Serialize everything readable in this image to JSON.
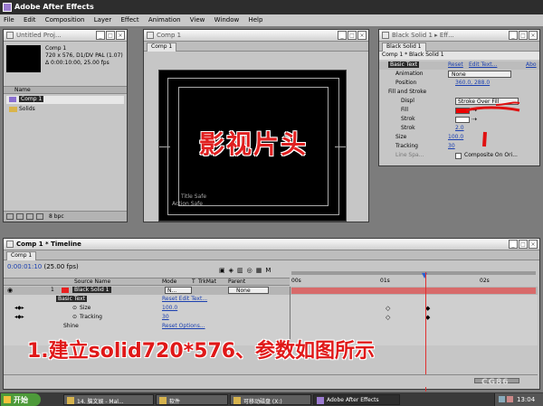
{
  "app": {
    "title": "Adobe After Effects",
    "menu": [
      "File",
      "Edit",
      "Composition",
      "Layer",
      "Effect",
      "Animation",
      "View",
      "Window",
      "Help"
    ]
  },
  "project": {
    "title": "Untitled Proj...",
    "comp_name": "Comp 1",
    "comp_size": "720 x 576, D1/DV PAL (1.07)",
    "comp_duration": "Δ 0:00:10:00, 25.00 fps",
    "column_name": "Name",
    "items": [
      {
        "label": "Comp 1"
      },
      {
        "label": "Solids"
      }
    ],
    "bpc": "8 bpc"
  },
  "comp_window": {
    "title": "Comp 1",
    "tab": "Comp 1",
    "overlay_text": "影视片头",
    "title_safe": "Title Safe",
    "action_safe": "Action Safe"
  },
  "effect_controls": {
    "title": "Black Solid 1 ▸ Eff...",
    "tab": "Black Solid 1",
    "breadcrumb": "Comp 1 * Black Solid 1",
    "effect_name": "Basic Text",
    "reset": "Reset",
    "edit_text": "Edit Text...",
    "about": "Abo",
    "animation_label": "Animation",
    "animation_value": "None",
    "position_label": "Position",
    "position_value": "360.0, 288.0",
    "fill_stroke": "Fill and Stroke",
    "display_label": "Displ",
    "display_value": "Stroke Over Fill",
    "fill_label": "Fill",
    "stroke_label": "Strok",
    "stroke_width_label": "Strok",
    "stroke_width_value": "2.0",
    "size_label": "Size",
    "size_value": "100.0",
    "tracking_label": "Tracking",
    "tracking_value": "30",
    "line_spacing_label": "Line Spa...",
    "composite_label": "Composite On Ori..."
  },
  "timeline": {
    "title": "Comp 1 * Timeline",
    "tab": "Comp 1",
    "timecode": "0:00:01:10",
    "fps": "(25.00 fps)",
    "col_source": "Source Name",
    "col_mode": "Mode",
    "col_t": "T",
    "col_trkmat": "TrkMat",
    "col_parent": "Parent",
    "layer_num": "1",
    "layer_name": "Black Solid 1",
    "layer_mode": "N...",
    "layer_parent": "None",
    "effect_name": "Basic Text",
    "reset_edit": "Reset Edit Text...",
    "size_label": "Size",
    "size_value": "100.0",
    "tracking_label": "Tracking",
    "tracking_value": "30",
    "shine_label": "Shine",
    "shine_reset": "Reset Options...",
    "ruler": [
      "00s",
      "01s",
      "02s"
    ]
  },
  "annotation": "1.建立solid720*576、参数如图所示",
  "watermark": "CG86",
  "taskbar": {
    "start": "开始",
    "items": [
      "14. 脑文娱 - Mal...",
      "软件",
      "可移动磁盘 (X:)",
      "Adobe After Effects"
    ],
    "clock": "13:04"
  }
}
